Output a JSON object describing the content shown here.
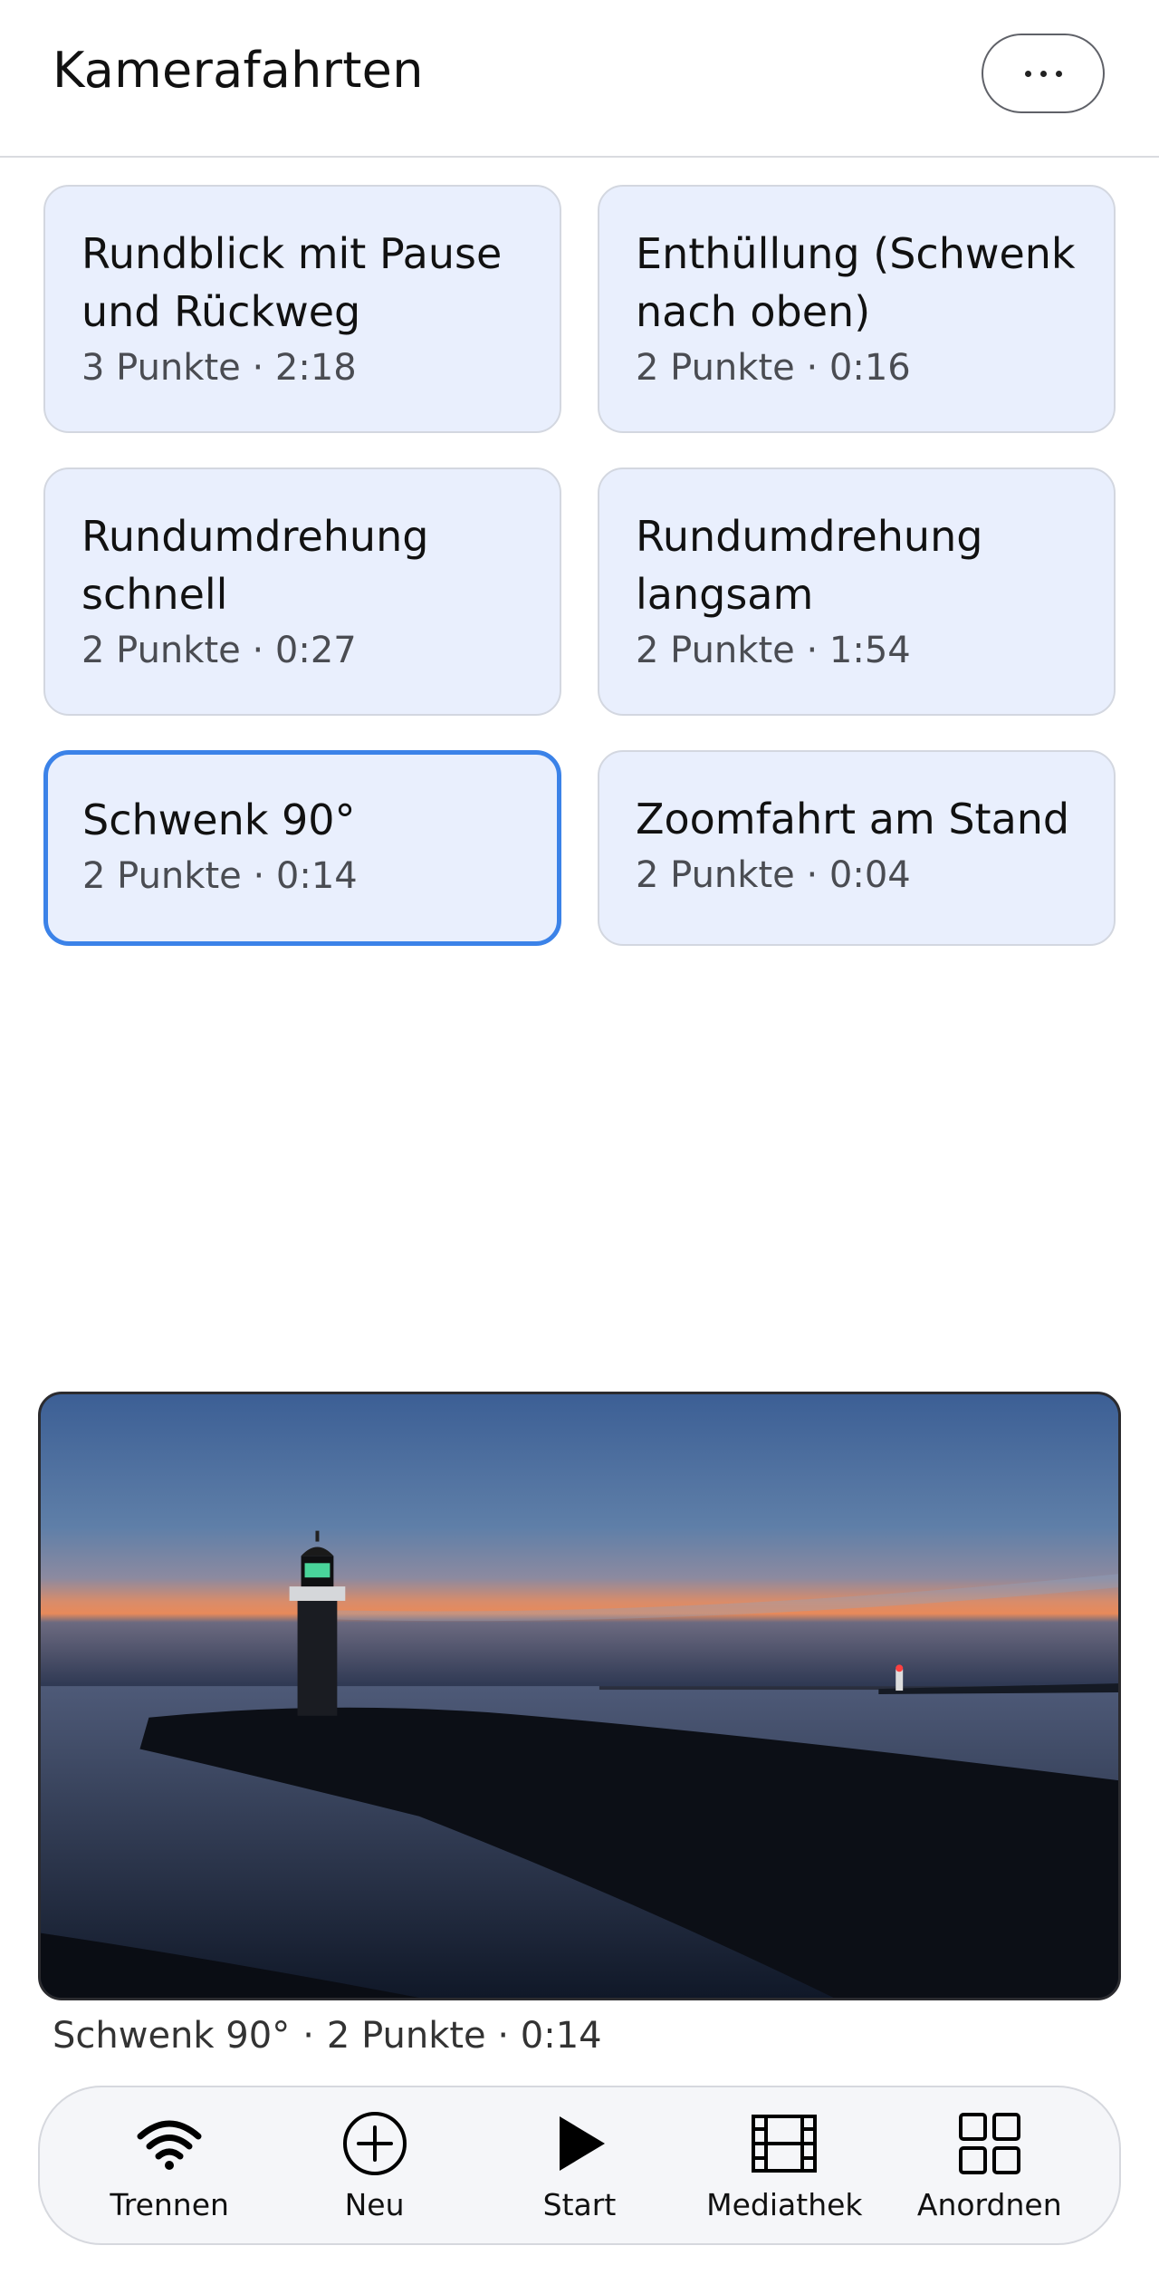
{
  "header": {
    "title": "Kamerafahrten"
  },
  "cards": [
    {
      "title_line1": "Rundblick mit Pause",
      "title_line2": "und Rückweg",
      "meta": "3 Punkte · 2:18",
      "selected": false
    },
    {
      "title_line1": "Enthüllung (Schwenk",
      "title_line2": "nach oben)",
      "meta": "2 Punkte · 0:16",
      "selected": false
    },
    {
      "title_line1": "Rundumdrehung",
      "title_line2": "schnell",
      "meta": "2 Punkte · 0:27",
      "selected": false
    },
    {
      "title_line1": "Rundumdrehung",
      "title_line2": "langsam",
      "meta": "2 Punkte · 1:54",
      "selected": false
    },
    {
      "title_line1": "Schwenk 90°",
      "title_line2": "",
      "meta": "2 Punkte · 0:14",
      "selected": true
    },
    {
      "title_line1": "Zoomfahrt am Stand",
      "title_line2": "",
      "meta": "2 Punkte · 0:04",
      "selected": false
    }
  ],
  "preview": {
    "caption_name": "Schwenk 90°",
    "caption_separator": "·",
    "caption_meta": "2 Punkte · 0:14"
  },
  "toolbar": {
    "items": [
      {
        "label": "Trennen",
        "icon": "wifi-icon"
      },
      {
        "label": "Neu",
        "icon": "plus-circle-icon"
      },
      {
        "label": "Start",
        "icon": "play-icon"
      },
      {
        "label": "Mediathek",
        "icon": "film-icon"
      },
      {
        "label": "Anordnen",
        "icon": "grid-icon"
      }
    ]
  },
  "colors": {
    "card_background": "#e9effd",
    "selected_border": "#3b82e8",
    "toolbar_background": "#f5f6f9"
  }
}
